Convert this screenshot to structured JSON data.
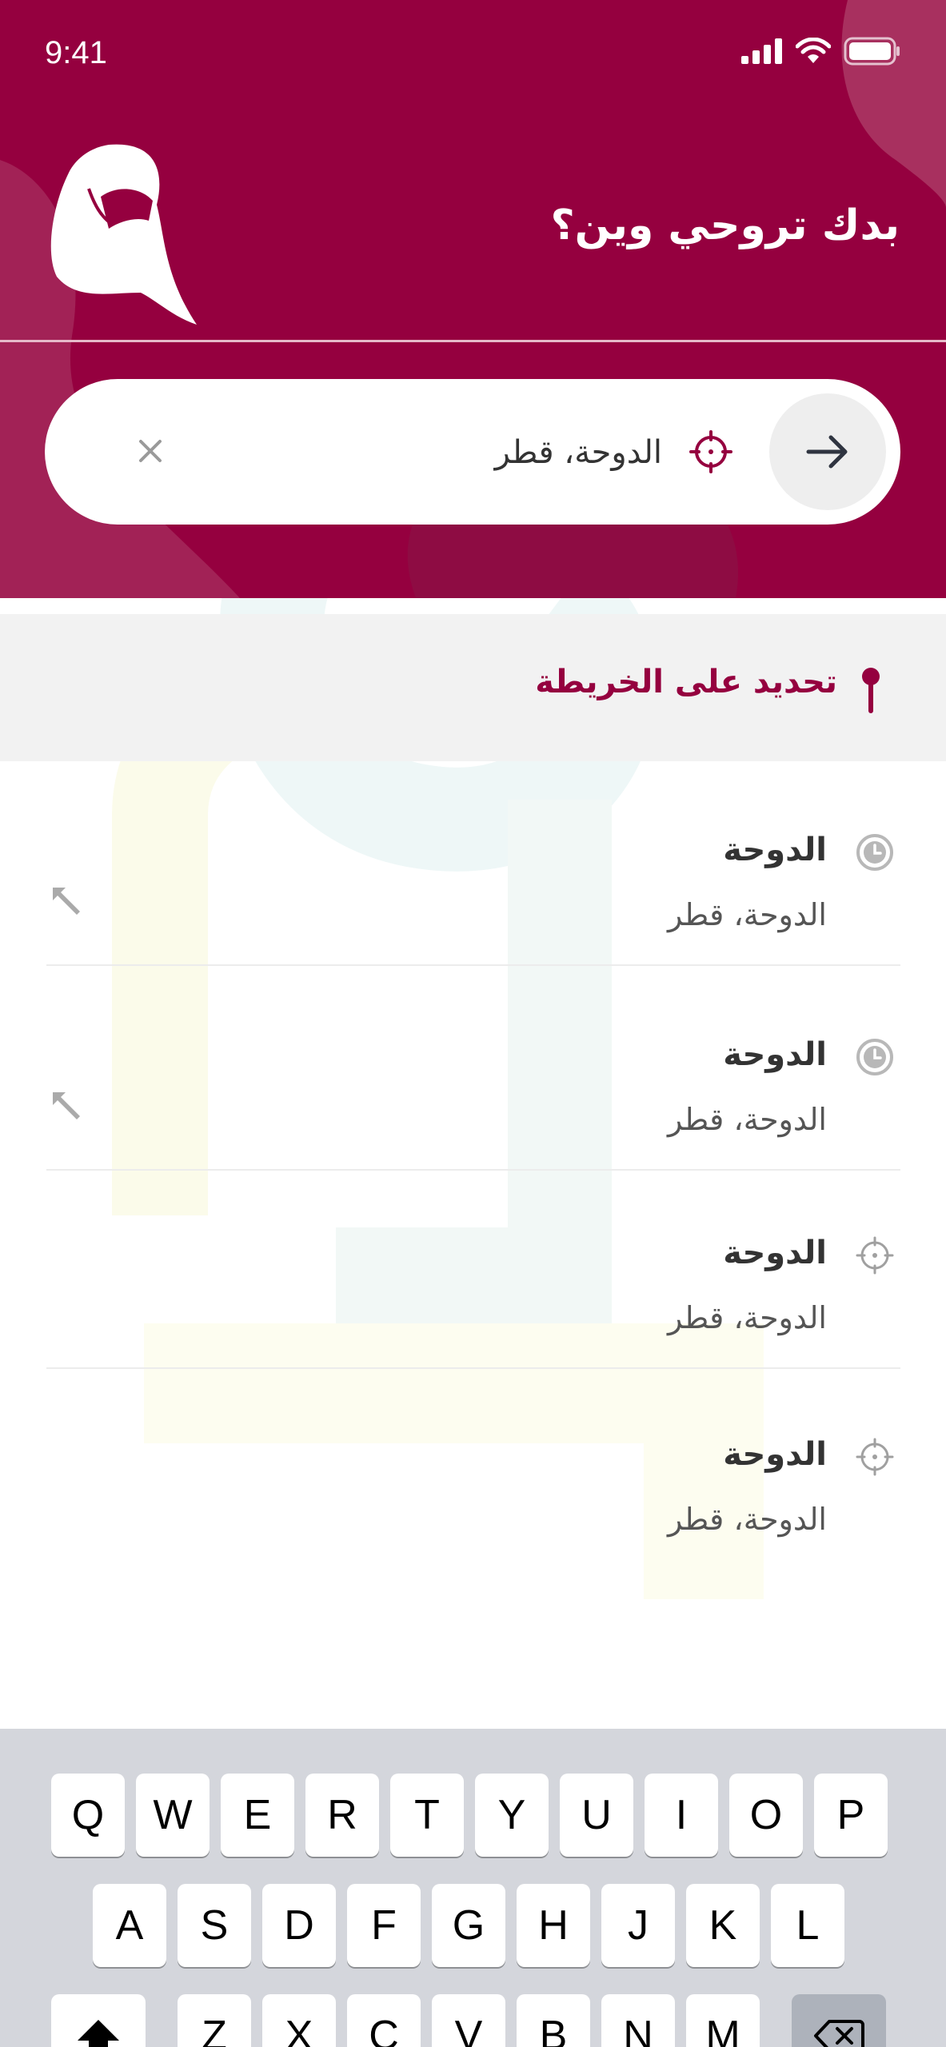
{
  "status_bar": {
    "time": "9:41"
  },
  "header": {
    "title": "بدك تروحي وين؟"
  },
  "search": {
    "value": "الدوحة، قطر",
    "clear_label": "×"
  },
  "map_select": {
    "label": "تحديد على الخريطة"
  },
  "results": [
    {
      "title": "الدوحة",
      "subtitle": "الدوحة، قطر",
      "icon": "clock-icon",
      "has_arrow": true
    },
    {
      "title": "الدوحة",
      "subtitle": "الدوحة، قطر",
      "icon": "clock-icon",
      "has_arrow": true
    },
    {
      "title": "الدوحة",
      "subtitle": "الدوحة، قطر",
      "icon": "location-target-icon",
      "has_arrow": false
    },
    {
      "title": "الدوحة",
      "subtitle": "الدوحة، قطر",
      "icon": "location-target-icon",
      "has_arrow": false
    }
  ],
  "keyboard": {
    "row1": [
      "Q",
      "W",
      "E",
      "R",
      "T",
      "Y",
      "U",
      "I",
      "O",
      "P"
    ],
    "row2": [
      "A",
      "S",
      "D",
      "F",
      "G",
      "H",
      "J",
      "K",
      "L"
    ],
    "row3": [
      "Z",
      "X",
      "C",
      "V",
      "B",
      "N",
      "M"
    ]
  },
  "colors": {
    "brand": "#95003f",
    "background": "#ffffff",
    "keyboard": "#d4d6dc"
  }
}
